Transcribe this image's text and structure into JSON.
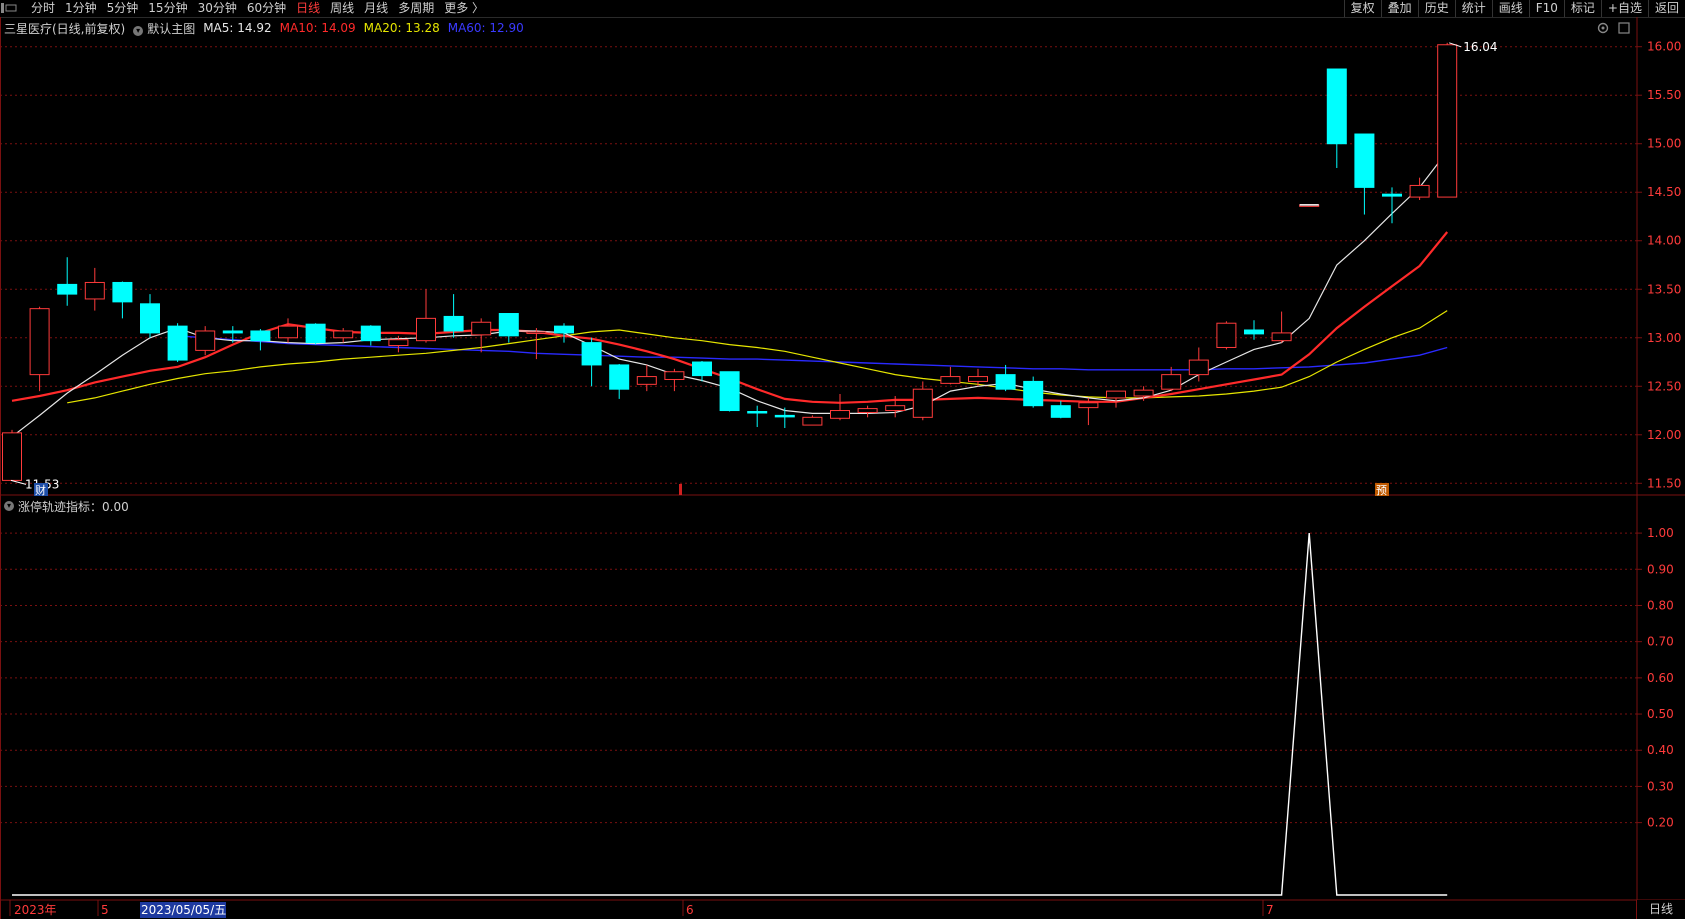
{
  "toolbar": {
    "periods": [
      "分时",
      "1分钟",
      "5分钟",
      "15分钟",
      "30分钟",
      "60分钟",
      "日线",
      "周线",
      "月线",
      "多周期",
      "更多 〉"
    ],
    "active_period": "日线",
    "tools": [
      "复权",
      "叠加",
      "历史",
      "统计",
      "画线",
      "F10",
      "标记",
      "+自选",
      "返回"
    ]
  },
  "main_legend": {
    "stock": "三星医疗(日线,前复权)",
    "template": "默认主图",
    "ma5": "MA5: 14.92",
    "ma10": "MA10: 14.09",
    "ma20": "MA20: 13.28",
    "ma60": "MA60: 12.90"
  },
  "indicator_legend": {
    "label": "涨停轨迹指标：0.00"
  },
  "markers": {
    "cai": "财",
    "yu": "预",
    "high_label": "16.04",
    "low_label": "11.53"
  },
  "date_axis": {
    "year": "2023年",
    "m5": "5",
    "cursor_date": "2023/05/05/五",
    "m6": "6",
    "m7": "7"
  },
  "footer": {
    "tab": "日线"
  },
  "colors": {
    "up": "#ff3b3b",
    "down": "#00ffff",
    "ma5": "#e6e6e6",
    "ma10": "#ff2a2a",
    "ma20": "#e6e600",
    "ma60": "#2a2aff",
    "grid": "#7a1010",
    "axis_text": "#ff3b3b"
  },
  "chart_data": [
    {
      "type": "candlestick",
      "title": "三星医疗(日线,前复权)",
      "ylim": [
        11.4,
        16.1
      ],
      "y_ticks": [
        11.5,
        12.0,
        12.5,
        13.0,
        13.5,
        14.0,
        14.5,
        15.0,
        15.5,
        16.0
      ],
      "y_tick_labels": [
        "11.50",
        "12.00",
        "12.50",
        "13.00",
        "13.50",
        "14.00",
        "14.50",
        "15.00",
        "15.50",
        "16.00"
      ],
      "candles": [
        {
          "o": 11.53,
          "h": 12.05,
          "l": 11.53,
          "c": 12.02
        },
        {
          "o": 12.62,
          "h": 13.32,
          "l": 12.45,
          "c": 13.3
        },
        {
          "o": 13.55,
          "h": 13.83,
          "l": 13.33,
          "c": 13.45
        },
        {
          "o": 13.4,
          "h": 13.72,
          "l": 13.28,
          "c": 13.57
        },
        {
          "o": 13.57,
          "h": 13.58,
          "l": 13.2,
          "c": 13.37
        },
        {
          "o": 13.35,
          "h": 13.45,
          "l": 13.0,
          "c": 13.05
        },
        {
          "o": 13.12,
          "h": 13.15,
          "l": 12.75,
          "c": 12.77
        },
        {
          "o": 12.87,
          "h": 13.12,
          "l": 12.82,
          "c": 13.07
        },
        {
          "o": 13.07,
          "h": 13.12,
          "l": 12.95,
          "c": 13.05
        },
        {
          "o": 13.07,
          "h": 13.09,
          "l": 12.87,
          "c": 12.97
        },
        {
          "o": 13.0,
          "h": 13.2,
          "l": 12.95,
          "c": 13.12
        },
        {
          "o": 13.14,
          "h": 13.15,
          "l": 12.93,
          "c": 12.95
        },
        {
          "o": 13.0,
          "h": 13.1,
          "l": 12.95,
          "c": 13.07
        },
        {
          "o": 13.12,
          "h": 13.13,
          "l": 12.92,
          "c": 12.97
        },
        {
          "o": 12.92,
          "h": 13.02,
          "l": 12.85,
          "c": 12.98
        },
        {
          "o": 12.97,
          "h": 13.5,
          "l": 12.95,
          "c": 13.2
        },
        {
          "o": 13.22,
          "h": 13.45,
          "l": 13.0,
          "c": 13.07
        },
        {
          "o": 13.03,
          "h": 13.2,
          "l": 12.85,
          "c": 13.16
        },
        {
          "o": 13.25,
          "h": 13.25,
          "l": 12.95,
          "c": 13.02
        },
        {
          "o": 13.05,
          "h": 13.1,
          "l": 12.78,
          "c": 13.06
        },
        {
          "o": 13.12,
          "h": 13.15,
          "l": 12.95,
          "c": 13.05
        },
        {
          "o": 12.95,
          "h": 13.0,
          "l": 12.5,
          "c": 12.72
        },
        {
          "o": 12.72,
          "h": 12.73,
          "l": 12.37,
          "c": 12.47
        },
        {
          "o": 12.52,
          "h": 12.72,
          "l": 12.45,
          "c": 12.6
        },
        {
          "o": 12.57,
          "h": 12.68,
          "l": 12.45,
          "c": 12.65
        },
        {
          "o": 12.75,
          "h": 12.76,
          "l": 12.55,
          "c": 12.61
        },
        {
          "o": 12.65,
          "h": 12.65,
          "l": 12.24,
          "c": 12.25
        },
        {
          "o": 12.24,
          "h": 12.3,
          "l": 12.08,
          "c": 12.23
        },
        {
          "o": 12.2,
          "h": 12.28,
          "l": 12.07,
          "c": 12.19
        },
        {
          "o": 12.1,
          "h": 12.2,
          "l": 12.1,
          "c": 12.18
        },
        {
          "o": 12.17,
          "h": 12.42,
          "l": 12.15,
          "c": 12.25
        },
        {
          "o": 12.23,
          "h": 12.3,
          "l": 12.18,
          "c": 12.27
        },
        {
          "o": 12.25,
          "h": 12.4,
          "l": 12.18,
          "c": 12.3
        },
        {
          "o": 12.18,
          "h": 12.55,
          "l": 12.15,
          "c": 12.47
        },
        {
          "o": 12.53,
          "h": 12.7,
          "l": 12.52,
          "c": 12.6
        },
        {
          "o": 12.55,
          "h": 12.68,
          "l": 12.5,
          "c": 12.6
        },
        {
          "o": 12.62,
          "h": 12.72,
          "l": 12.45,
          "c": 12.47
        },
        {
          "o": 12.55,
          "h": 12.6,
          "l": 12.28,
          "c": 12.3
        },
        {
          "o": 12.3,
          "h": 12.35,
          "l": 12.17,
          "c": 12.18
        },
        {
          "o": 12.28,
          "h": 12.38,
          "l": 12.1,
          "c": 12.33
        },
        {
          "o": 12.38,
          "h": 12.45,
          "l": 12.28,
          "c": 12.45
        },
        {
          "o": 12.4,
          "h": 12.5,
          "l": 12.35,
          "c": 12.46
        },
        {
          "o": 12.47,
          "h": 12.7,
          "l": 12.45,
          "c": 12.62
        },
        {
          "o": 12.62,
          "h": 12.9,
          "l": 12.55,
          "c": 12.77
        },
        {
          "o": 12.9,
          "h": 13.17,
          "l": 12.88,
          "c": 13.15
        },
        {
          "o": 13.08,
          "h": 13.18,
          "l": 12.98,
          "c": 13.04
        },
        {
          "o": 12.97,
          "h": 13.27,
          "l": 12.95,
          "c": 13.05
        },
        {
          "o": 14.37,
          "h": 14.37,
          "l": 14.37,
          "c": 14.37
        },
        {
          "o": 15.77,
          "h": 15.77,
          "l": 14.75,
          "c": 15.0
        },
        {
          "o": 15.1,
          "h": 15.1,
          "l": 14.27,
          "c": 14.55
        },
        {
          "o": 14.48,
          "h": 14.55,
          "l": 14.18,
          "c": 14.46
        },
        {
          "o": 14.45,
          "h": 14.65,
          "l": 14.42,
          "c": 14.57
        },
        {
          "o": 14.45,
          "h": 16.04,
          "l": 14.45,
          "c": 16.02
        }
      ],
      "ma": {
        "ma5": [
          11.98,
          12.2,
          12.43,
          12.62,
          12.82,
          13.0,
          13.1,
          13.0,
          12.97,
          12.97,
          12.95,
          12.94,
          12.95,
          12.98,
          12.99,
          13.0,
          13.02,
          13.03,
          13.07,
          13.07,
          13.05,
          12.92,
          12.78,
          12.72,
          12.62,
          12.56,
          12.48,
          12.35,
          12.25,
          12.22,
          12.22,
          12.22,
          12.23,
          12.3,
          12.45,
          12.5,
          12.53,
          12.47,
          12.42,
          12.38,
          12.35,
          12.38,
          12.46,
          12.62,
          12.75,
          12.88,
          12.95,
          13.2,
          13.75,
          14.0,
          14.28,
          14.55,
          14.92
        ],
        "ma10": [
          12.35,
          12.4,
          12.46,
          12.54,
          12.6,
          12.66,
          12.7,
          12.8,
          12.93,
          13.05,
          13.14,
          13.1,
          13.06,
          13.05,
          13.05,
          13.04,
          13.06,
          13.08,
          13.08,
          13.06,
          13.02,
          12.99,
          12.93,
          12.86,
          12.78,
          12.68,
          12.58,
          12.47,
          12.37,
          12.34,
          12.33,
          12.34,
          12.36,
          12.36,
          12.37,
          12.38,
          12.37,
          12.36,
          12.35,
          12.34,
          12.34,
          12.38,
          12.42,
          12.47,
          12.52,
          12.57,
          12.62,
          12.83,
          13.1,
          13.32,
          13.53,
          13.74,
          14.09
        ],
        "ma20": [
          12.33,
          12.38,
          12.45,
          12.52,
          12.58,
          12.63,
          12.66,
          12.7,
          12.73,
          12.75,
          12.78,
          12.8,
          12.82,
          12.84,
          12.87,
          12.9,
          12.94,
          12.98,
          13.02,
          13.06,
          13.08,
          13.04,
          13.0,
          12.97,
          12.93,
          12.9,
          12.86,
          12.8,
          12.74,
          12.68,
          12.62,
          12.58,
          12.55,
          12.52,
          12.48,
          12.44,
          12.41,
          12.39,
          12.38,
          12.38,
          12.39,
          12.4,
          12.42,
          12.45,
          12.49,
          12.6,
          12.75,
          12.88,
          13.0,
          13.1,
          13.28
        ],
        "ma60": [
          13.02,
          13.0,
          12.98,
          12.96,
          12.94,
          12.93,
          12.92,
          12.91,
          12.9,
          12.89,
          12.88,
          12.87,
          12.86,
          12.84,
          12.83,
          12.82,
          12.81,
          12.8,
          12.8,
          12.79,
          12.78,
          12.78,
          12.77,
          12.76,
          12.75,
          12.74,
          12.73,
          12.72,
          12.71,
          12.7,
          12.69,
          12.68,
          12.68,
          12.67,
          12.67,
          12.67,
          12.67,
          12.67,
          12.68,
          12.68,
          12.69,
          12.7,
          12.72,
          12.74,
          12.78,
          12.82,
          12.9
        ]
      }
    },
    {
      "type": "line",
      "title": "涨停轨迹指标：0.00",
      "ylim": [
        0,
        1.05
      ],
      "y_ticks": [
        0.2,
        0.3,
        0.4,
        0.5,
        0.6,
        0.7,
        0.8,
        0.9,
        1.0
      ],
      "y_tick_labels": [
        "0.20",
        "0.30",
        "0.40",
        "0.50",
        "0.60",
        "0.70",
        "0.80",
        "0.90",
        "1.00"
      ],
      "values": [
        0,
        0,
        0,
        0,
        0,
        0,
        0,
        0,
        0,
        0,
        0,
        0,
        0,
        0,
        0,
        0,
        0,
        0,
        0,
        0,
        0,
        0,
        0,
        0,
        0,
        0,
        0,
        0,
        0,
        0,
        0,
        0,
        0,
        0,
        0,
        0,
        0,
        0,
        0,
        0,
        0,
        0,
        0,
        0,
        0,
        0,
        0,
        1,
        0,
        0,
        0,
        0,
        0
      ]
    }
  ]
}
